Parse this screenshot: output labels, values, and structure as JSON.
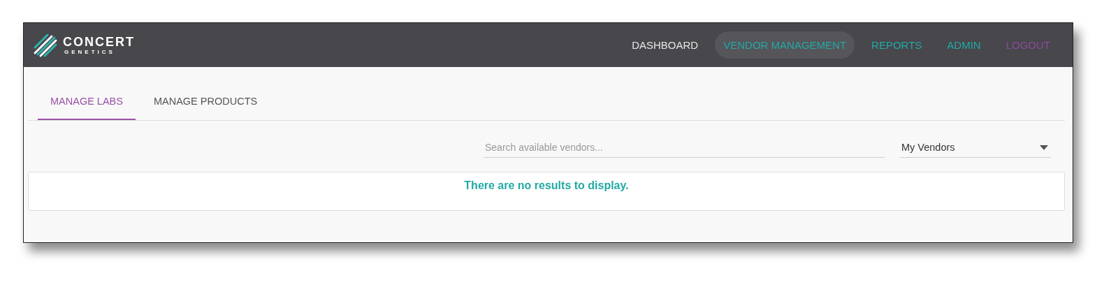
{
  "logo": {
    "name": "CONCERT",
    "subtitle": "GENETICS"
  },
  "nav": [
    {
      "label": "DASHBOARD",
      "selected": false,
      "color": "#e6e6e6"
    },
    {
      "label": "VENDOR MANAGEMENT",
      "selected": true,
      "color": "#22aaa5"
    },
    {
      "label": "REPORTS",
      "selected": false,
      "color": "#22aaa5"
    },
    {
      "label": "ADMIN",
      "selected": false,
      "color": "#22aaa5"
    },
    {
      "label": "LOGOUT",
      "selected": false,
      "color": "#8a4a9e"
    }
  ],
  "tabs": [
    {
      "label": "MANAGE LABS",
      "selected": true
    },
    {
      "label": "MANAGE PRODUCTS",
      "selected": false
    }
  ],
  "search": {
    "placeholder": "Search available vendors..."
  },
  "filter": {
    "value": "My Vendors"
  },
  "results": {
    "message": "There are no results to display."
  }
}
